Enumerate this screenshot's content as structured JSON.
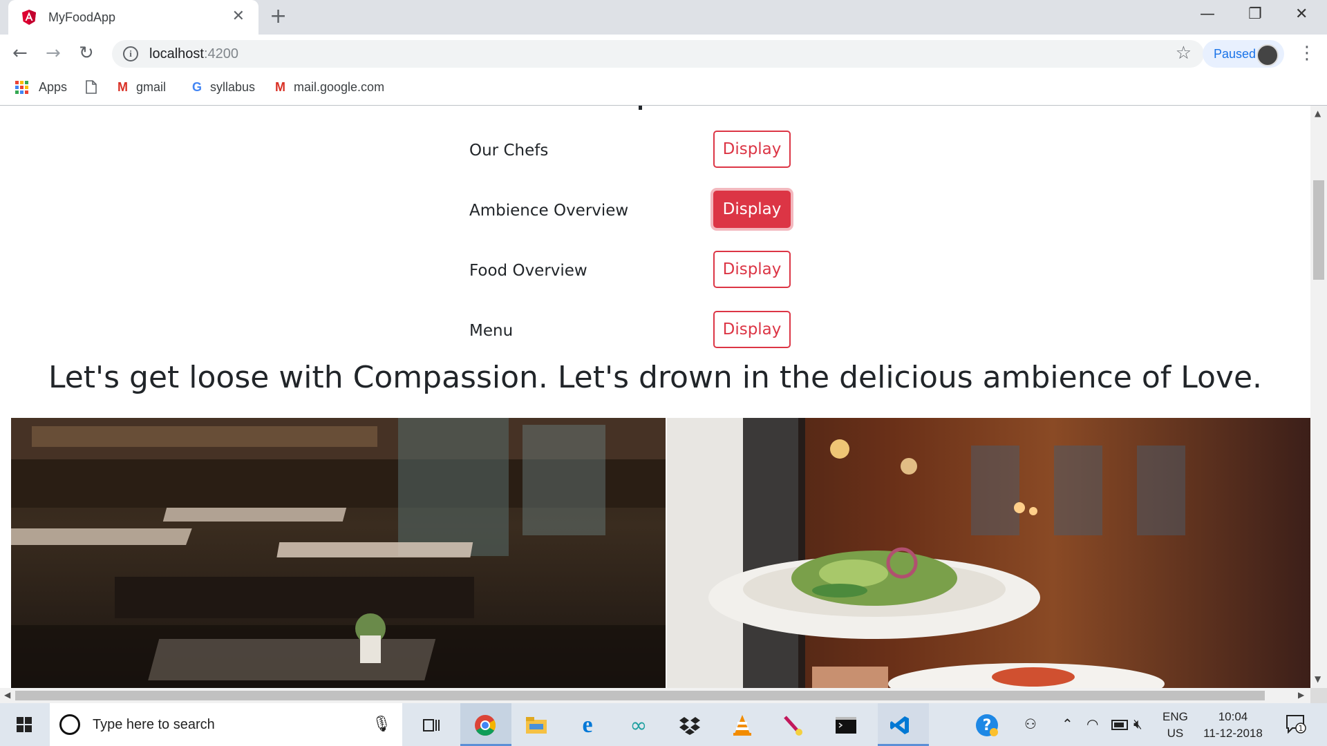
{
  "browser": {
    "tab_title": "MyFoodApp",
    "url_host": "localhost",
    "url_port": ":4200",
    "profile_status": "Paused",
    "tab_close_glyph": "✕",
    "new_tab_glyph": "+"
  },
  "bookmarks": [
    {
      "label": "Apps",
      "icon": "apps-grid-icon"
    },
    {
      "label": "",
      "icon": "document-icon"
    },
    {
      "label": "gmail",
      "icon": "gmail-icon"
    },
    {
      "label": "syllabus",
      "icon": "google-icon"
    },
    {
      "label": "mail.google.com",
      "icon": "gmail-icon"
    }
  ],
  "page": {
    "rows": [
      {
        "label": "Our Chefs",
        "button": "Display",
        "active": false
      },
      {
        "label": "Ambience Overview",
        "button": "Display",
        "active": true
      },
      {
        "label": "Food Overview",
        "button": "Display",
        "active": false
      },
      {
        "label": "Menu",
        "button": "Display",
        "active": false
      }
    ],
    "tagline": "Let's get loose with Compassion. Let's drown in the delicious ambience of Love.",
    "images": [
      {
        "name": "restaurant-interior-photo"
      },
      {
        "name": "waiter-salad-photo"
      }
    ]
  },
  "taskbar": {
    "search_placeholder": "Type here to search",
    "apps": [
      "task-view-icon",
      "chrome-icon",
      "file-explorer-icon",
      "edge-icon",
      "arduino-icon",
      "dropbox-icon",
      "vlc-icon",
      "paint-icon",
      "terminal-icon",
      "vscode-icon"
    ],
    "lang_top": "ENG",
    "lang_bottom": "US",
    "time": "10:04",
    "date": "11-12-2018",
    "notification_count": "1"
  },
  "colors": {
    "accent_red": "#dc3545",
    "chrome_blue": "#1a73e8"
  }
}
